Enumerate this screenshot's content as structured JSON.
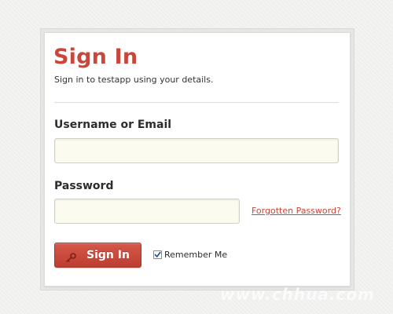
{
  "form": {
    "title": "Sign In",
    "subtitle": "Sign in to testapp using your details.",
    "username_label": "Username or Email",
    "username_value": "",
    "password_label": "Password",
    "password_value": "",
    "forgot_link": "Forgotten Password?",
    "submit_label": "Sign In",
    "submit_icon": "key-icon",
    "remember_label": "Remember Me",
    "remember_checked": true
  },
  "colors": {
    "accent": "#c8473a",
    "input_background": "#fbfbf0",
    "page_background": "#f0f0ef"
  },
  "watermark": "www.chhua.com"
}
